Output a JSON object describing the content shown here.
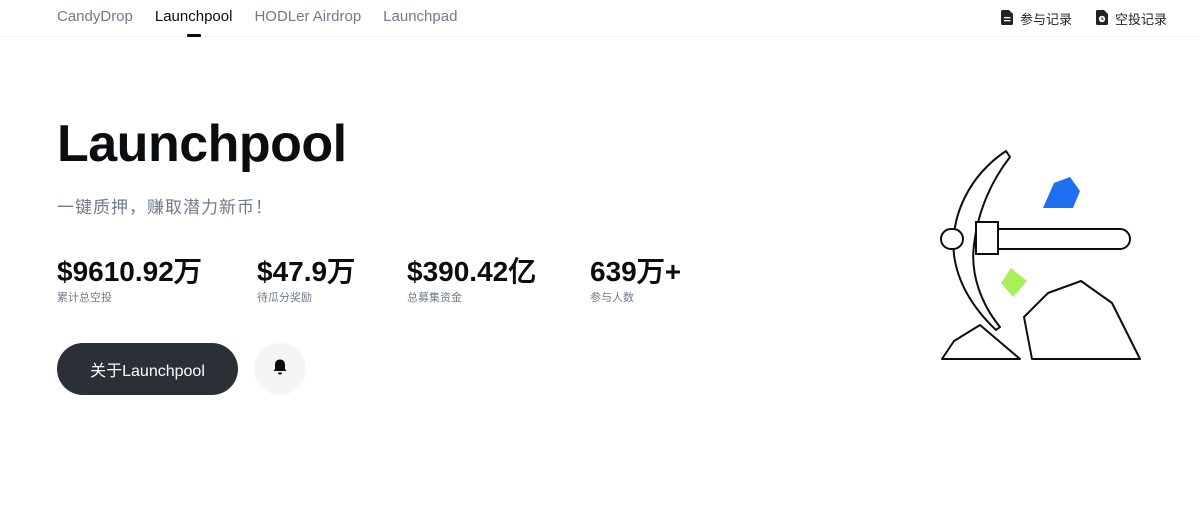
{
  "nav": {
    "tabs": [
      {
        "label": "CandyDrop",
        "active": false
      },
      {
        "label": "Launchpool",
        "active": true
      },
      {
        "label": "HODLer Airdrop",
        "active": false
      },
      {
        "label": "Launchpad",
        "active": false
      }
    ],
    "records": [
      {
        "label": "参与记录",
        "icon": "document-icon"
      },
      {
        "label": "空投记录",
        "icon": "clock-document-icon"
      }
    ]
  },
  "hero": {
    "title": "Launchpool",
    "subtitle": "一键质押，赚取潜力新币！"
  },
  "stats": [
    {
      "value": "$9610.92万",
      "label": "累计总空投"
    },
    {
      "value": "$47.9万",
      "label": "待瓜分奖励"
    },
    {
      "value": "$390.42亿",
      "label": "总募集资金"
    },
    {
      "value": "639万+",
      "label": "参与人数"
    }
  ],
  "actions": {
    "about_label": "关于Launchpool",
    "bell_icon": "bell-icon"
  },
  "colors": {
    "text_primary": "#0b0e11",
    "text_secondary": "#707a8a",
    "button_dark": "#2b2f36",
    "gem_blue": "#1d6ff2",
    "gem_green": "#a6f05a"
  }
}
